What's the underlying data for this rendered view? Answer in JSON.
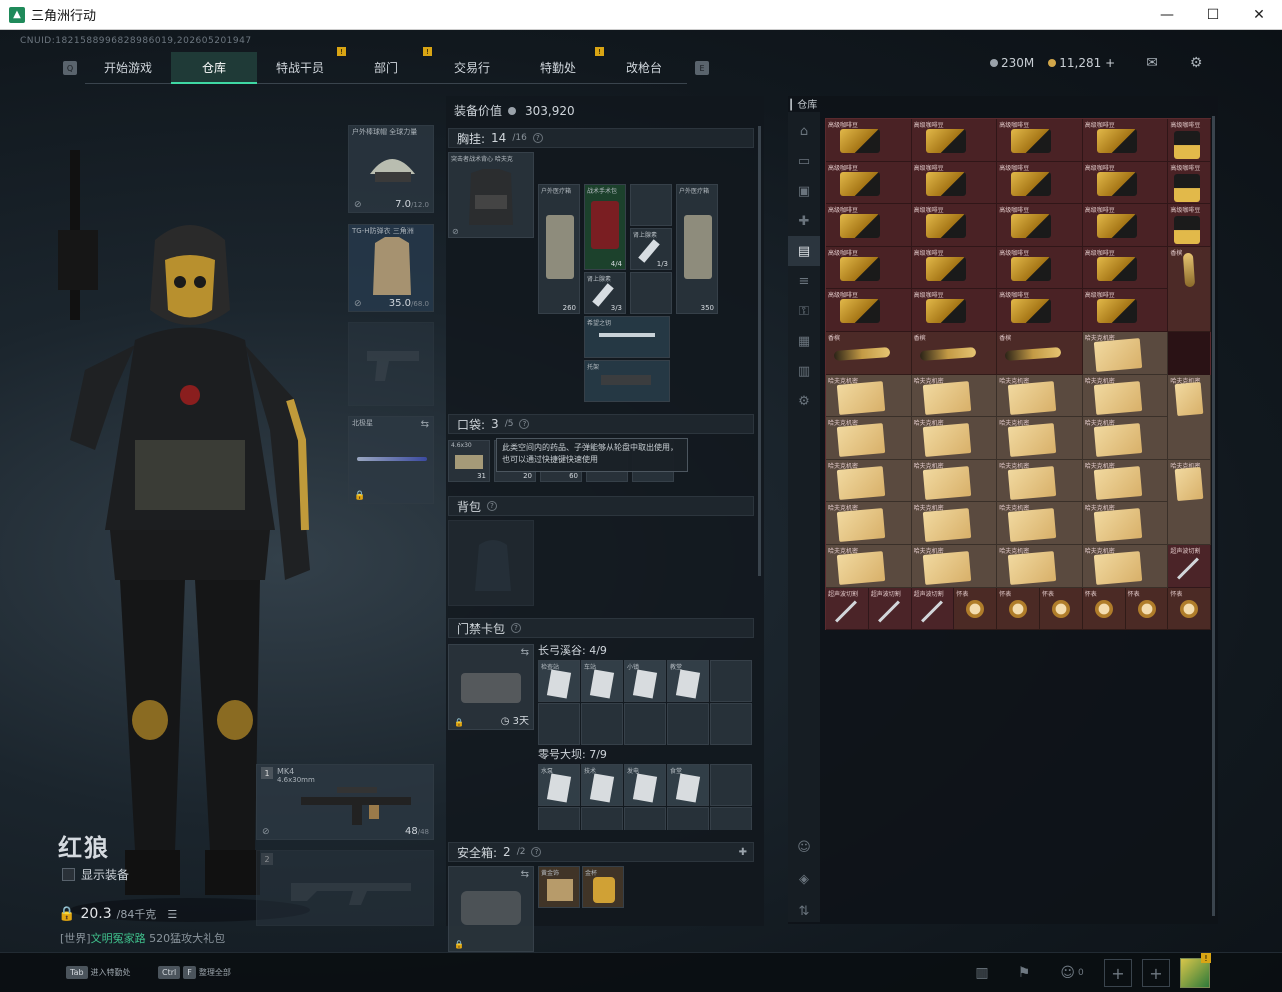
{
  "window": {
    "title": "三角洲行动",
    "minimize": "—",
    "maximize": "☐",
    "close": "✕"
  },
  "uid": "CNUID:1821588996828986019,202605201947",
  "nav": {
    "left_key": "Q",
    "right_key": "E",
    "tabs": [
      {
        "label": "开始游戏",
        "badge": ""
      },
      {
        "label": "仓库",
        "badge": "",
        "active": true
      },
      {
        "label": "特战干员",
        "badge": "!"
      },
      {
        "label": "部门",
        "badge": "!"
      },
      {
        "label": "交易行",
        "badge": ""
      },
      {
        "label": "特勤处",
        "badge": "!"
      },
      {
        "label": "改枪台",
        "badge": ""
      }
    ]
  },
  "currency": {
    "coins": "230M",
    "tickets": "11,281",
    "plus": "+"
  },
  "colors": {
    "accent": "#3fd8a4",
    "badge": "#d9a514",
    "storage_bg": "#2a1215"
  },
  "character": {
    "name": "红狼",
    "show_equipment": "显示装备",
    "weight": "20.3",
    "weight_max": "/84千克"
  },
  "chat": {
    "channel": "[世界]",
    "user": "文明冤家路",
    "text": "520猛攻大礼包"
  },
  "equip": {
    "helmet": {
      "label": "户外棒球帽 全球力量",
      "value": "7.0",
      "max": "/12.0"
    },
    "armor": {
      "label": "TG-H防弹衣 三角洲",
      "value": "35.0",
      "max": "/68.0"
    },
    "melee": {
      "label": "北极星"
    },
    "primary": {
      "index": "1",
      "label": "MK4",
      "sub": "4.6x30mm",
      "ammo": "48",
      "ammo_max": "/48"
    },
    "secondary": {
      "index": "2"
    }
  },
  "mid": {
    "value_label": "装备价值",
    "value": "303,920",
    "chest": {
      "label": "胸挂:",
      "count": "14",
      "max": "/16"
    },
    "chest_items": {
      "rig": "突击者战术背心 哈夫克",
      "kit1": {
        "label": "户外医疗箱",
        "cnt": "260"
      },
      "surgical": {
        "label": "战术手术包",
        "cnt": "4/4"
      },
      "syringe1": {
        "label": "肾上腺素",
        "cnt": "1/3"
      },
      "syringe2": {
        "label": "肾上腺素",
        "cnt": "3/3"
      },
      "kit2": {
        "label": "户外医疗箱",
        "cnt": "350"
      },
      "key": {
        "label": "希望之钥"
      },
      "grip": {
        "label": "托架"
      }
    },
    "pocket": {
      "label": "口袋:",
      "count": "3",
      "max": "/5"
    },
    "pocket_items": {
      "ammo": {
        "label": "4.6x30",
        "cnt": "31"
      },
      "c2": "20",
      "c3": "60"
    },
    "tooltip": "此类空间内的药品、子弹能够从轮盘中取出使用，也可以通过快捷键快速使用",
    "backpack": {
      "label": "背包"
    },
    "keycase": {
      "label": "门禁卡包",
      "days": "3天"
    },
    "key_group1": {
      "label": "长弓溪谷: 4/9",
      "keys": [
        "检查站",
        "车站",
        "小镇",
        "教堂"
      ]
    },
    "key_group2": {
      "label": "零号大坝: 7/9",
      "keys": [
        "水泵",
        "技术",
        "发电",
        "食堂"
      ]
    },
    "safe": {
      "label": "安全箱:",
      "count": "2",
      "max": "/2"
    },
    "safe_items": [
      "黄金饰",
      "金杯"
    ]
  },
  "storage": {
    "title": "仓库",
    "items": [
      {
        "t": "coffee",
        "n": "高级咖啡豆"
      },
      {
        "t": "coffee",
        "n": "高级咖啡豆"
      },
      {
        "t": "coffee",
        "n": "高级咖啡豆"
      },
      {
        "t": "coffee",
        "n": "高级咖啡豆"
      },
      {
        "t": "coffee tall",
        "n": "高级咖啡豆"
      },
      {
        "t": "coffee",
        "n": "高级咖啡豆"
      },
      {
        "t": "coffee",
        "n": "高级咖啡豆"
      },
      {
        "t": "coffee",
        "n": "高级咖啡豆"
      },
      {
        "t": "coffee",
        "n": "高级咖啡豆"
      },
      {
        "t": "coffee tall",
        "n": "高级咖啡豆"
      },
      {
        "t": "coffee",
        "n": "高级咖啡豆"
      },
      {
        "t": "coffee",
        "n": "高级咖啡豆"
      },
      {
        "t": "coffee",
        "n": "高级咖啡豆"
      },
      {
        "t": "coffee",
        "n": "高级咖啡豆"
      },
      {
        "t": "coffee tall",
        "n": "高级咖啡豆"
      },
      {
        "t": "coffee",
        "n": "高级咖啡豆"
      },
      {
        "t": "coffee",
        "n": "高级咖啡豆"
      },
      {
        "t": "coffee",
        "n": "高级咖啡豆"
      },
      {
        "t": "coffee",
        "n": "高级咖啡豆"
      },
      {
        "t": "champ up",
        "n": "香槟"
      },
      {
        "t": "coffee",
        "n": "高级咖啡豆"
      },
      {
        "t": "coffee",
        "n": "高级咖啡豆"
      },
      {
        "t": "coffee",
        "n": "高级咖啡豆"
      },
      {
        "t": "coffee",
        "n": "高级咖啡豆"
      },
      {
        "t": "champ",
        "n": "香槟"
      },
      {
        "t": "champ",
        "n": "香槟"
      },
      {
        "t": "champ",
        "n": "香槟"
      },
      {
        "t": "doc",
        "n": "哈夫克机密"
      },
      {
        "t": "doc",
        "n": "哈夫克机密"
      },
      {
        "t": "doc",
        "n": "哈夫克机密"
      },
      {
        "t": "doc",
        "n": "哈夫克机密"
      },
      {
        "t": "doc",
        "n": "哈夫克机密"
      },
      {
        "t": "doc single",
        "n": "哈夫克机密"
      },
      {
        "t": "doc",
        "n": "哈夫克机密"
      },
      {
        "t": "doc",
        "n": "哈夫克机密"
      },
      {
        "t": "doc",
        "n": "哈夫克机密"
      },
      {
        "t": "doc",
        "n": "哈夫克机密"
      },
      {
        "t": "doc",
        "n": "哈夫克机密"
      },
      {
        "t": "doc",
        "n": "哈夫克机密"
      },
      {
        "t": "doc",
        "n": "哈夫克机密"
      },
      {
        "t": "doc",
        "n": "哈夫克机密"
      },
      {
        "t": "doc single",
        "n": "哈夫克机密"
      },
      {
        "t": "doc",
        "n": "哈夫克机密"
      },
      {
        "t": "doc",
        "n": "哈夫克机密"
      },
      {
        "t": "doc",
        "n": "哈夫克机密"
      },
      {
        "t": "doc",
        "n": "哈夫克机密"
      },
      {
        "t": "doc",
        "n": "哈夫克机密"
      },
      {
        "t": "doc",
        "n": "哈夫克机密"
      },
      {
        "t": "doc",
        "n": "哈夫克机密"
      },
      {
        "t": "doc",
        "n": "哈夫克机密"
      },
      {
        "t": "pen",
        "n": "超声波切割"
      },
      {
        "t": "pen",
        "n": "超声波切割"
      },
      {
        "t": "pen",
        "n": "超声波切割"
      },
      {
        "t": "pen",
        "n": "超声波切割"
      },
      {
        "t": "watch",
        "n": "怀表"
      },
      {
        "t": "watch",
        "n": "怀表"
      },
      {
        "t": "watch",
        "n": "怀表"
      },
      {
        "t": "watch",
        "n": "怀表"
      },
      {
        "t": "watch",
        "n": "怀表"
      },
      {
        "t": "watch",
        "n": "怀表"
      }
    ]
  },
  "bottom": {
    "tab_key": "Tab",
    "tab_text": "进入特勤处",
    "ctrl_key": "Ctrl",
    "f_key": "F",
    "ctrl_text": "整理全部",
    "friends": "0",
    "avatar_badge": "!"
  }
}
